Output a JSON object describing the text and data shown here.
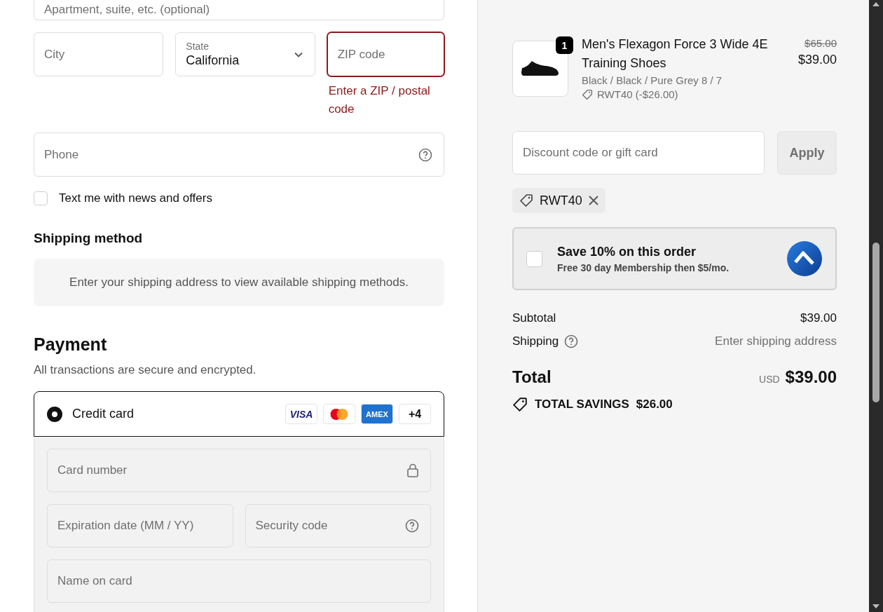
{
  "address": {
    "apartment": {
      "placeholder": "Apartment, suite, etc. (optional)"
    },
    "city": {
      "placeholder": "City"
    },
    "state": {
      "label": "State",
      "value": "California"
    },
    "zip": {
      "placeholder": "ZIP code",
      "invalid": true,
      "error": "Enter a ZIP / postal code"
    },
    "phone": {
      "placeholder": "Phone"
    },
    "sms_opt_in": {
      "label": "Text me with news and offers",
      "checked": false
    }
  },
  "shipping_method": {
    "title": "Shipping method",
    "notice": "Enter your shipping address to view available shipping methods."
  },
  "payment": {
    "title": "Payment",
    "subtitle": "All transactions are secure and encrypted.",
    "methods": [
      {
        "label": "Credit card",
        "selected": true,
        "brands": [
          {
            "kind": "visa",
            "text": "VISA"
          },
          {
            "kind": "mastercard"
          },
          {
            "kind": "amex",
            "text": "AMEX"
          },
          {
            "kind": "more",
            "text": "+4"
          }
        ]
      }
    ],
    "fields": [
      {
        "placeholder": "Card number",
        "kind": "lock"
      },
      {
        "placeholder": "Expiration date (MM / YY)",
        "kind": "half"
      },
      {
        "placeholder": "Security code",
        "kind": "help"
      },
      {
        "placeholder": "Name on card",
        "kind": "plain"
      }
    ]
  },
  "order": {
    "item": {
      "quantity": "1",
      "name": "Men's Flexagon Force 3 Wide 4E Training Shoes",
      "variant": "Black / Black / Pure Grey 8 / 7",
      "discount": "RWT40 (-$26.00)",
      "original_price": "$65.00",
      "price": "$39.00"
    },
    "discount": {
      "placeholder": "Discount code or gift card",
      "button": "Apply"
    },
    "applied_codes": [
      {
        "code": "RWT40"
      }
    ],
    "membership": {
      "checked": false,
      "title": "Save 10% on this order",
      "subtitle": "Free 30 day Membership then $5/mo."
    },
    "summary": {
      "subtotal_label": "Subtotal",
      "subtotal": "$39.00",
      "shipping_label": "Shipping",
      "shipping": "Enter shipping address",
      "total_label": "Total",
      "currency": "USD",
      "total": "$39.00",
      "savings_label": "TOTAL SAVINGS",
      "savings": "$26.00"
    }
  }
}
